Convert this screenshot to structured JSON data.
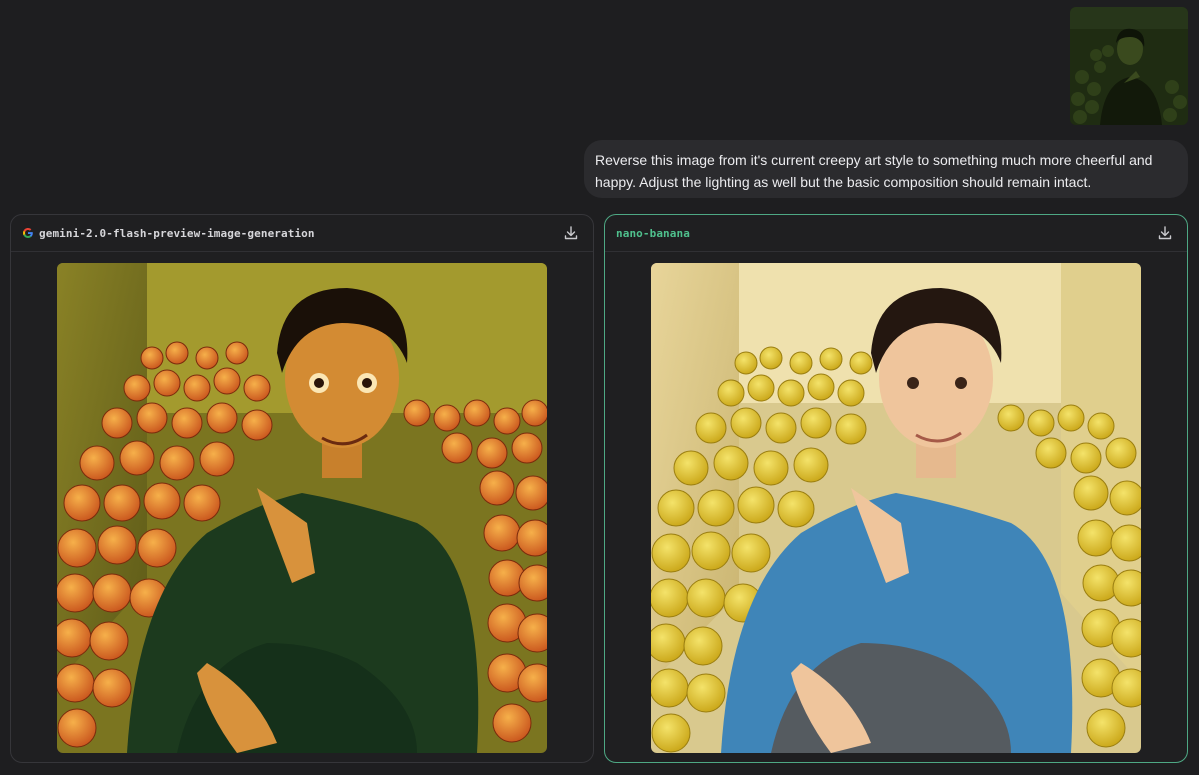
{
  "conversation": {
    "user_image_alt": "user-uploaded creepy portrait",
    "user_prompt": "Reverse this image from it's current creepy art style to something much more cheerful and happy. Adjust the lighting as well but the basic composition should remain intact."
  },
  "results": [
    {
      "model": "gemini-2.0-flash-preview-image-generation",
      "icon": "google-g-icon",
      "action_icon": "download-icon"
    },
    {
      "model": "nano-banana",
      "icon": "",
      "action_icon": "download-icon"
    }
  ],
  "colors": {
    "background": "#1e1e20",
    "panel_border": "#36363a",
    "selected_border": "#4ea884",
    "selected_model_text": "#4fc08d",
    "bubble": "#2b2b2e"
  }
}
